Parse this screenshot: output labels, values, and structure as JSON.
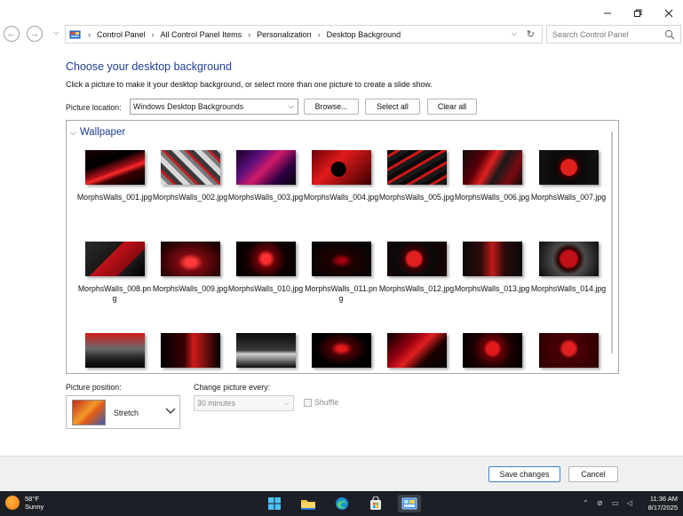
{
  "window": {
    "minimize_label": "—",
    "maximize_label": "□",
    "close_label": "✕"
  },
  "address": {
    "crumbs": [
      "Control Panel",
      "All Control Panel Items",
      "Personalization",
      "Desktop Background"
    ],
    "search_placeholder": "Search Control Panel"
  },
  "main": {
    "title": "Choose your desktop background",
    "description": "Click a picture to make it your desktop background, or select more than one picture to create a slide show.",
    "picture_location_label": "Picture location:",
    "picture_location_value": "Windows Desktop Backgrounds",
    "browse_label": "Browse...",
    "select_all_label": "Select all",
    "clear_all_label": "Clear all",
    "group_label": "Wallpaper"
  },
  "wallpapers": [
    {
      "name": "MorphsWalls_001.jpg",
      "theme": "t1"
    },
    {
      "name": "MorphsWalls_002.jpg",
      "theme": "t2"
    },
    {
      "name": "MorphsWalls_003.jpg",
      "theme": "t3"
    },
    {
      "name": "MorphsWalls_004.jpg",
      "theme": "t4"
    },
    {
      "name": "MorphsWalls_005.jpg",
      "theme": "t5"
    },
    {
      "name": "MorphsWalls_006.jpg",
      "theme": "t6"
    },
    {
      "name": "MorphsWalls_007.jpg",
      "theme": "t7"
    },
    {
      "name": "MorphsWalls_008.png",
      "theme": "t8"
    },
    {
      "name": "MorphsWalls_009.jpg",
      "theme": "t9"
    },
    {
      "name": "MorphsWalls_010.jpg",
      "theme": "t10"
    },
    {
      "name": "MorphsWalls_011.png",
      "theme": "t11"
    },
    {
      "name": "MorphsWalls_012.jpg",
      "theme": "t12"
    },
    {
      "name": "MorphsWalls_013.jpg",
      "theme": "t13"
    },
    {
      "name": "MorphsWalls_014.jpg",
      "theme": "t14"
    },
    {
      "name": "",
      "theme": "t15"
    },
    {
      "name": "",
      "theme": "t16"
    },
    {
      "name": "",
      "theme": "t17"
    },
    {
      "name": "",
      "theme": "t18"
    },
    {
      "name": "",
      "theme": "t19"
    },
    {
      "name": "",
      "theme": "t20"
    },
    {
      "name": "",
      "theme": "t21"
    }
  ],
  "options": {
    "picture_position_label": "Picture position:",
    "picture_position_value": "Stretch",
    "change_every_label": "Change picture every:",
    "change_every_value": "30 minutes",
    "shuffle_label": "Shuffle"
  },
  "footer": {
    "save_label": "Save changes",
    "cancel_label": "Cancel"
  },
  "taskbar": {
    "temperature": "58°F",
    "condition": "Sunny",
    "time": "11:36 AM",
    "date": "8/17/2025"
  }
}
